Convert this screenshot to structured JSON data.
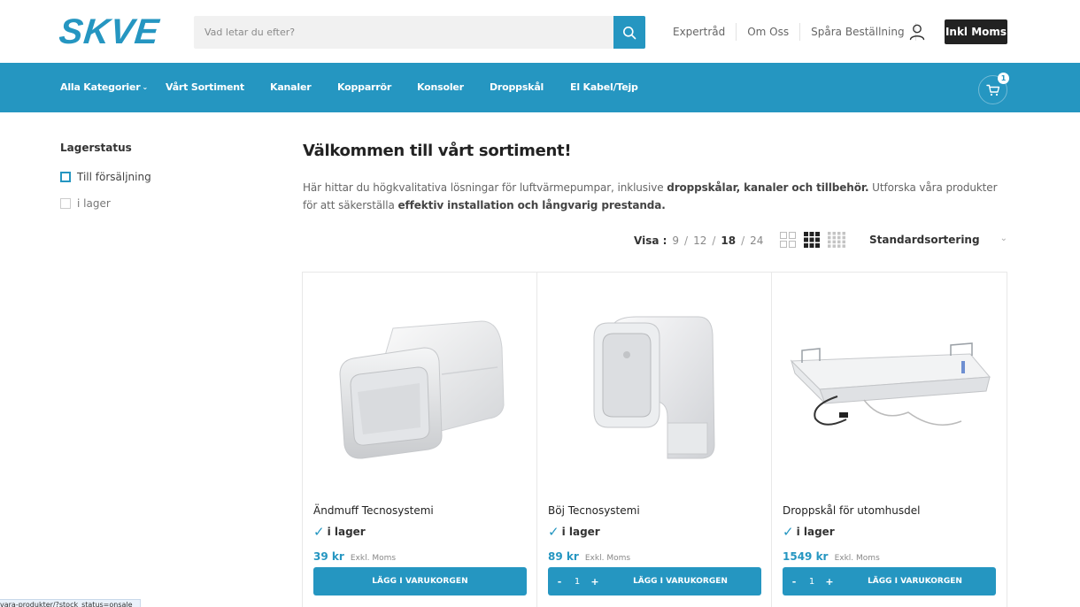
{
  "header": {
    "logo": "SKVE",
    "search_placeholder": "Vad letar du efter?",
    "links": [
      "Expertråd",
      "Om Oss",
      "Spåra Beställning"
    ],
    "moms_button": "Inkl Moms"
  },
  "nav": {
    "items": [
      "Alla Kategorier",
      "Vårt Sortiment",
      "Kanaler",
      "Kopparrör",
      "Konsoler",
      "Droppskål",
      "El Kabel/Tejp"
    ],
    "cart_count": "1"
  },
  "sidebar": {
    "title": "Lagerstatus",
    "filters": [
      "Till försäljning",
      "i lager"
    ]
  },
  "main": {
    "title": "Välkommen till vårt sortiment!",
    "intro_1": "Här hittar du högkvalitativa lösningar för luftvärmepumpar, inklusive ",
    "intro_b1": "droppskålar, kanaler och tillbehör.",
    "intro_2": " Utforska våra produkter för att säkerställa ",
    "intro_b2": "effektiv installation och långvarig prestanda.",
    "visa_label": "Visa :",
    "visa_options": [
      "9",
      "12",
      "18",
      "24"
    ],
    "visa_active": "18",
    "sort_label": "Standardsortering"
  },
  "products": [
    {
      "name": "Ändmuff Tecnosystemi",
      "stock": "i lager",
      "price": "39 kr",
      "tax_label": "Exkl. Moms",
      "button": "LÄGG I VARUKORGEN",
      "qty": ""
    },
    {
      "name": "Böj Tecnosystemi",
      "stock": "i lager",
      "price": "89 kr",
      "tax_label": "Exkl. Moms",
      "button": "LÄGG I VARUKORGEN",
      "qty": "1"
    },
    {
      "name": "Droppskål för utomhusdel",
      "stock": "i lager",
      "price": "1549 kr",
      "tax_label": "Exkl. Moms",
      "button": "LÄGG I VARUKORGEN",
      "qty": "1"
    }
  ],
  "statusbar": "vara-produkter/?stock_status=onsale",
  "colors": {
    "brand": "#2596c1",
    "dark": "#222222"
  },
  "icons": [
    "search-icon",
    "user-icon",
    "cart-icon",
    "grid-2-icon",
    "grid-3-icon",
    "grid-4-icon",
    "checkmark-icon"
  ]
}
